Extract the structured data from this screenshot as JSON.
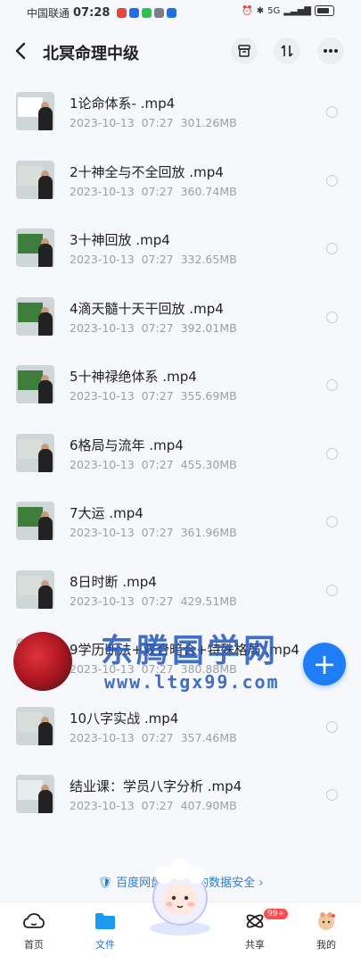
{
  "status_bar": {
    "carrier": "中国联通",
    "time": "07:28",
    "network": "5G",
    "app_colors": [
      "#e8453c",
      "#1e6ff0",
      "#2bc24f",
      "#7a7f87",
      "#1a73e8"
    ]
  },
  "header": {
    "title": "北冥命理中级",
    "back_icon": "chevron-left-icon",
    "buttons": [
      "archive-icon",
      "sort-icon",
      "more-icon"
    ]
  },
  "files": [
    {
      "name": "1论命体系-  .mp4",
      "date": "2023-10-13",
      "time": "07:27",
      "size": "301.26MB",
      "thumb": "#ffffff"
    },
    {
      "name": "2十神全与不全回放  .mp4",
      "date": "2023-10-13",
      "time": "07:27",
      "size": "360.74MB",
      "thumb": "#d9dedb"
    },
    {
      "name": "3十神回放  .mp4",
      "date": "2023-10-13",
      "time": "07:27",
      "size": "332.65MB",
      "thumb": "#3f7d3a"
    },
    {
      "name": "4滴天髓十天干回放  .mp4",
      "date": "2023-10-13",
      "time": "07:27",
      "size": "392.01MB",
      "thumb": "#3f7d3a"
    },
    {
      "name": "5十神禄绝体系  .mp4",
      "date": "2023-10-13",
      "time": "07:27",
      "size": "355.69MB",
      "thumb": "#3f7d3a"
    },
    {
      "name": "6格局与流年  .mp4",
      "date": "2023-10-13",
      "time": "07:27",
      "size": "455.30MB",
      "thumb": "#d9dedb"
    },
    {
      "name": "7大运  .mp4",
      "date": "2023-10-13",
      "time": "07:27",
      "size": "361.96MB",
      "thumb": "#3f7d3a"
    },
    {
      "name": "8日时断  .mp4",
      "date": "2023-10-13",
      "time": "07:27",
      "size": "429.51MB",
      "thumb": "#d9dedb"
    },
    {
      "name": "9学历断法+双合暗合+特殊格局  .mp4",
      "date": "2023-10-13",
      "time": "07:27",
      "size": "380.88MB",
      "thumb": "#3f7d3a"
    },
    {
      "name": "10八字实战  .mp4",
      "date": "2023-10-13",
      "time": "07:27",
      "size": "357.46MB",
      "thumb": "#d9dedb"
    },
    {
      "name": "结业课：学员八字分析  .mp4",
      "date": "2023-10-13",
      "time": "07:27",
      "size": "407.90MB",
      "thumb": "#e7ecef"
    }
  ],
  "fab": {
    "label": "+",
    "color": "#1f7ef7"
  },
  "watermark": {
    "line1": "东腾国学网",
    "line2": "www.ltgx99.com"
  },
  "safety_banner": "百度网盘保障你的数据安全 ›",
  "tabs": [
    {
      "label": "首页",
      "icon": "cloud-icon"
    },
    {
      "label": "文件",
      "icon": "folder-icon"
    },
    {
      "label": "共享",
      "icon": "share-icon"
    },
    {
      "label": "我的",
      "icon": "avatar-icon"
    }
  ],
  "share_badge": "99+"
}
